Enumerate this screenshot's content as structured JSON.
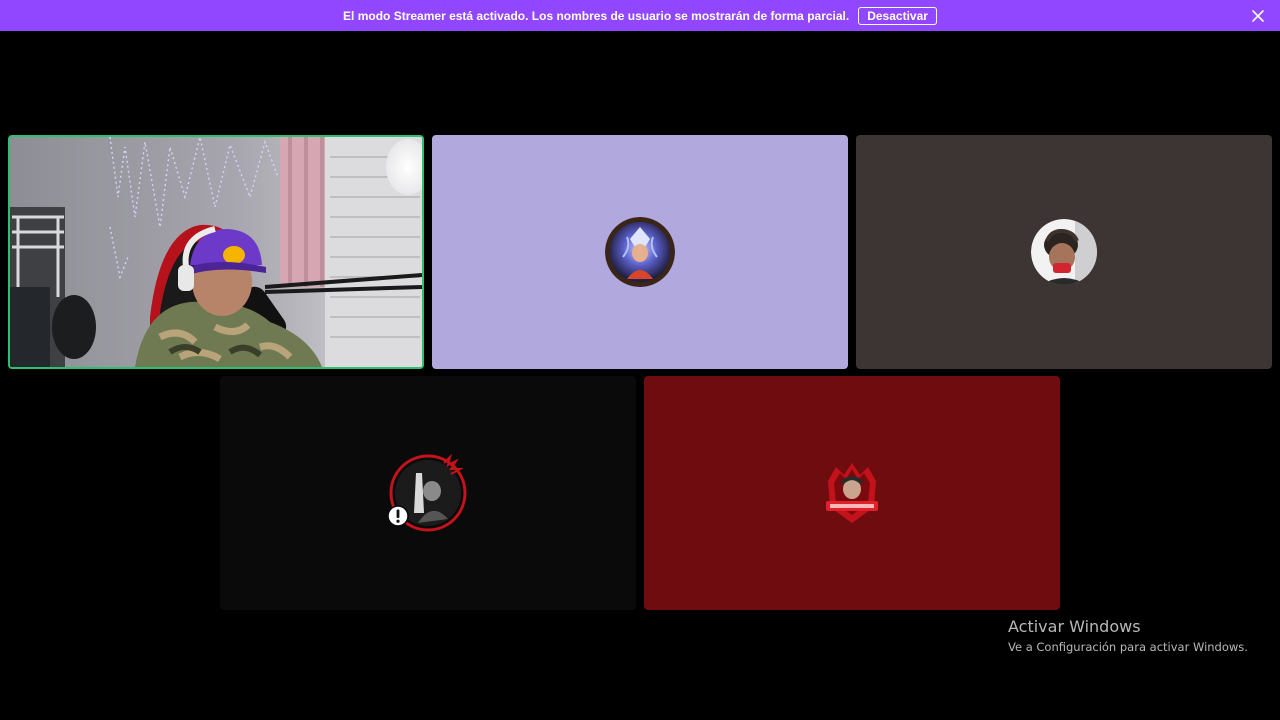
{
  "banner": {
    "message": "El modo Streamer está activado. Los nombres de usuario se mostrarán de forma parcial.",
    "button_label": "Desactivar",
    "close_icon": "close-icon",
    "background": "#9147ff"
  },
  "tiles": [
    {
      "type": "video",
      "border_color": "#2fbf71",
      "speaking": true
    },
    {
      "type": "avatar",
      "background": "#b1a9dd",
      "avatar": "anime-character-avatar"
    },
    {
      "type": "avatar",
      "background": "#3d3533",
      "avatar": "person-avatar"
    },
    {
      "type": "avatar",
      "background": "#0a0a0a",
      "avatar": "red-ring-character-avatar",
      "badge_icon": "exclamation-badge-icon"
    },
    {
      "type": "avatar",
      "background": "#6e0c10",
      "avatar": "red-emblem-logo-avatar"
    }
  ],
  "watermark": {
    "title": "Activar Windows",
    "subtitle": "Ve a Configuración para activar Windows."
  }
}
